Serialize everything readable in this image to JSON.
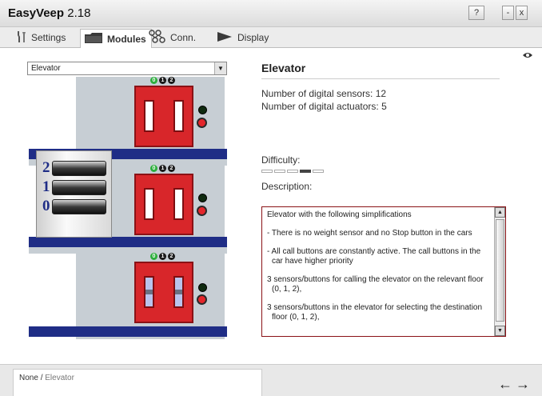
{
  "app": {
    "name": "EasyVeep",
    "version": "2.18"
  },
  "window_buttons": {
    "help": "?",
    "minimize": "-",
    "close": "x"
  },
  "tabs": [
    {
      "label": "Settings",
      "icon": "tools-icon"
    },
    {
      "label": "Modules",
      "icon": "folder-icon"
    },
    {
      "label": "Conn.",
      "icon": "connection-icon"
    },
    {
      "label": "Display",
      "icon": "play-icon"
    }
  ],
  "module_select": {
    "value": "Elevator"
  },
  "elevator": {
    "indicator": [
      "0",
      "1",
      "2"
    ],
    "car_floors": [
      "2",
      "1",
      "0"
    ]
  },
  "details": {
    "title": "Elevator",
    "sensors": "Number of digital sensors: 12",
    "actuators": "Number of digital actuators: 5",
    "difficulty_label": "Difficulty:",
    "difficulty_level": 4,
    "difficulty_max": 5,
    "description_label": "Description:",
    "description": [
      "Elevator with the following simplifications",
      "- There is no weight sensor and no Stop button in the cars",
      "- All call buttons are constantly active. The call buttons in the car have higher priority",
      "3 sensors/buttons for calling the elevator on the relevant floor (0, 1, 2),",
      "3 sensors/buttons in the elevator for selecting the destination floor (0, 1, 2),"
    ]
  },
  "breadcrumb": {
    "root": "None",
    "separator": "/",
    "current": "Elevator"
  },
  "nav": {
    "back": "←",
    "forward": "→"
  },
  "colors": {
    "floor": "#1f2d86",
    "door": "#d8262a",
    "shaft": "#c7ced4",
    "description_border": "#8a1216"
  }
}
